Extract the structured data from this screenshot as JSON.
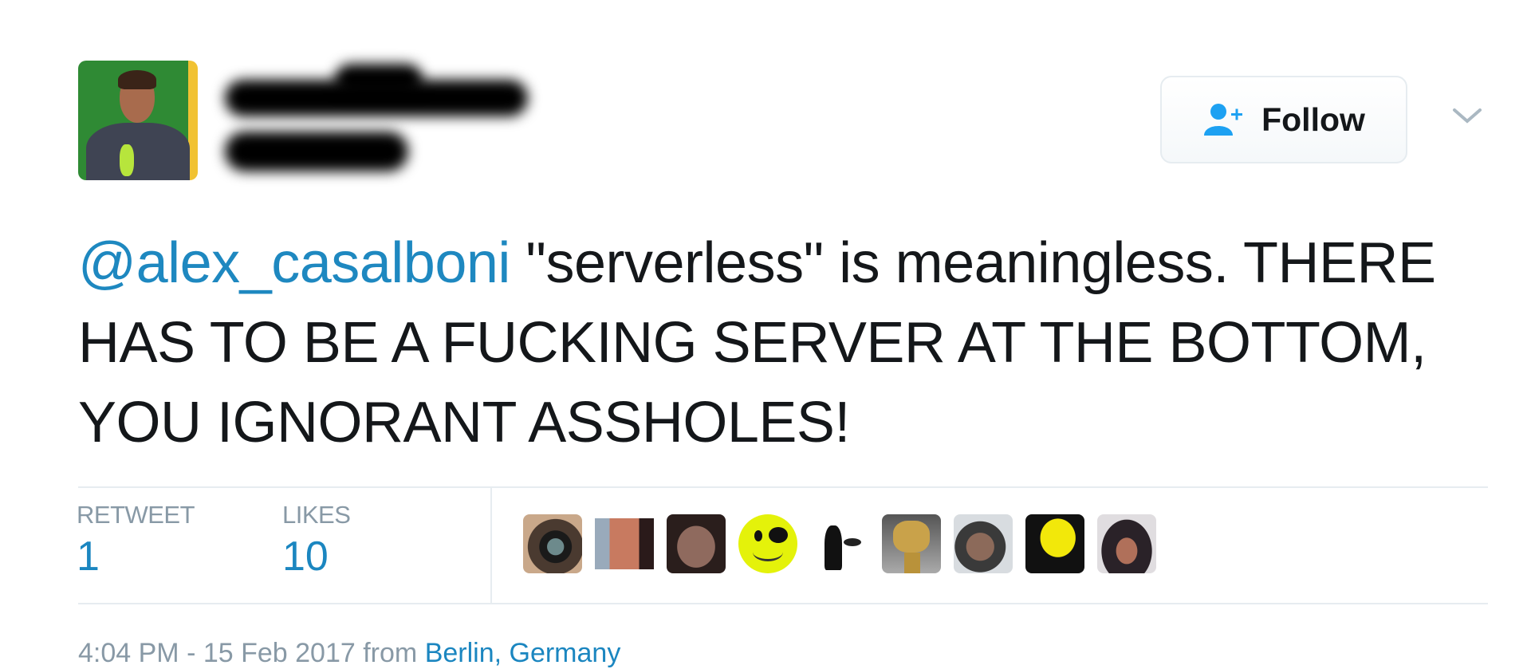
{
  "author": {
    "display_name": "[redacted]",
    "handle": "[redacted]",
    "avatar": "author-avatar"
  },
  "follow_button": {
    "label": "Follow",
    "icon": "user-plus-icon",
    "accent": "#1da1f2"
  },
  "more_menu": {
    "icon": "chevron-down-icon"
  },
  "tweet": {
    "mention": "@alex_casalboni",
    "text": " \"serverless\" is meaningless. THERE HAS TO BE A FUCKING SERVER AT THE BOTTOM, YOU IGNORANT ASSHOLES!"
  },
  "stats": [
    {
      "label": "RETWEET",
      "count": "1"
    },
    {
      "label": "LIKES",
      "count": "10"
    }
  ],
  "likers": [
    {
      "name": "liker-eye-avatar"
    },
    {
      "name": "liker-photo-avatar"
    },
    {
      "name": "liker-face-avatar"
    },
    {
      "name": "liker-pirate-smiley-avatar"
    },
    {
      "name": "liker-silhouette-avatar"
    },
    {
      "name": "liker-gold-statue-avatar"
    },
    {
      "name": "liker-selfie-avatar"
    },
    {
      "name": "liker-yellow-portrait-avatar"
    },
    {
      "name": "liker-hat-avatar"
    }
  ],
  "meta": {
    "time": "4:04 PM - 15 Feb 2017",
    "from": " from ",
    "location": "Berlin, Germany"
  },
  "colors": {
    "link": "#1b86c0",
    "text": "#14171a",
    "muted": "#8899a6",
    "divider": "#e6ecf0"
  }
}
